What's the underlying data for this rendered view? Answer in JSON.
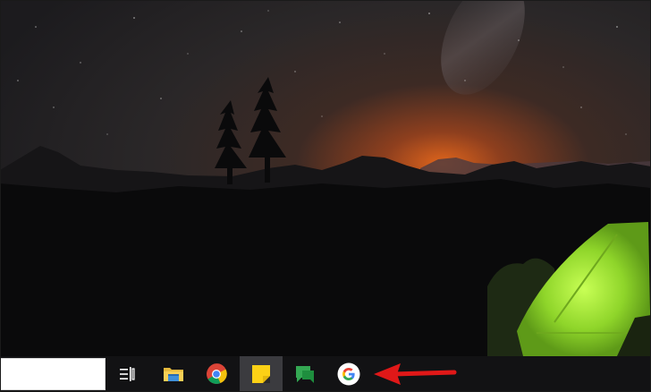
{
  "desktop": {
    "wallpaper": "night-mountains-tent",
    "colors": {
      "sky_top": "#2e2c2f",
      "glow": "#d35a18",
      "tent": "#9fe62e"
    }
  },
  "taskbar": {
    "background": "#121214",
    "search": {
      "placeholder": "",
      "value": ""
    },
    "buttons": [
      {
        "name": "task-view-button",
        "icon": "task-view-icon",
        "active": false
      },
      {
        "name": "file-explorer-button",
        "icon": "folder-icon",
        "active": false
      },
      {
        "name": "chrome-button",
        "icon": "chrome-icon",
        "active": false
      },
      {
        "name": "sticky-notes-button",
        "icon": "sticky-notes-icon",
        "active": true
      },
      {
        "name": "google-chat-button",
        "icon": "google-chat-icon",
        "active": false
      },
      {
        "name": "google-button",
        "icon": "google-g-icon",
        "active": false
      }
    ]
  },
  "annotation": {
    "type": "arrow",
    "color": "#e01818",
    "points_to": "google-button"
  }
}
